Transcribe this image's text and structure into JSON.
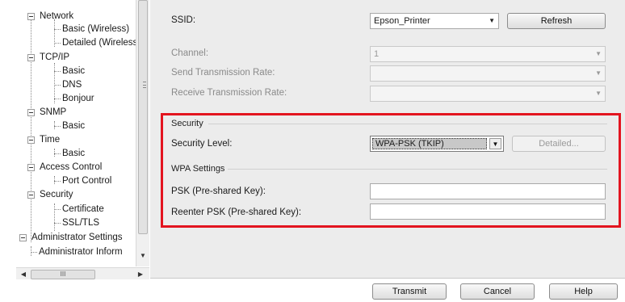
{
  "tree": {
    "items": [
      {
        "label": "Network"
      },
      {
        "label": "Basic (Wireless)"
      },
      {
        "label": "Detailed (Wireless"
      },
      {
        "label": "TCP/IP"
      },
      {
        "label": "Basic"
      },
      {
        "label": "DNS"
      },
      {
        "label": "Bonjour"
      },
      {
        "label": "SNMP"
      },
      {
        "label": "Basic"
      },
      {
        "label": "Time"
      },
      {
        "label": "Basic"
      },
      {
        "label": "Access Control"
      },
      {
        "label": "Port Control"
      },
      {
        "label": "Security"
      },
      {
        "label": "Certificate"
      },
      {
        "label": "SSL/TLS"
      },
      {
        "label": "Administrator Settings"
      },
      {
        "label": "Administrator Inform"
      }
    ],
    "hscroll_thumb": "III"
  },
  "form": {
    "ssid_label": "SSID:",
    "ssid_value": "Epson_Printer",
    "refresh_label": "Refresh",
    "channel_label": "Channel:",
    "channel_value": "1",
    "send_rate_label": "Send Transmission Rate:",
    "receive_rate_label": "Receive Transmission Rate:",
    "security_group": "Security",
    "security_level_label": "Security Level:",
    "security_level_value": "WPA-PSK (TKIP)",
    "detailed_label": "Detailed...",
    "wpa_group": "WPA Settings",
    "psk_label": "PSK (Pre-shared Key):",
    "reenter_psk_label": "Reenter PSK (Pre-shared Key):"
  },
  "buttons": {
    "transmit": "Transmit",
    "cancel": "Cancel",
    "help": "Help"
  },
  "colors": {
    "highlight": "#e3141f",
    "panel": "#ececec"
  }
}
